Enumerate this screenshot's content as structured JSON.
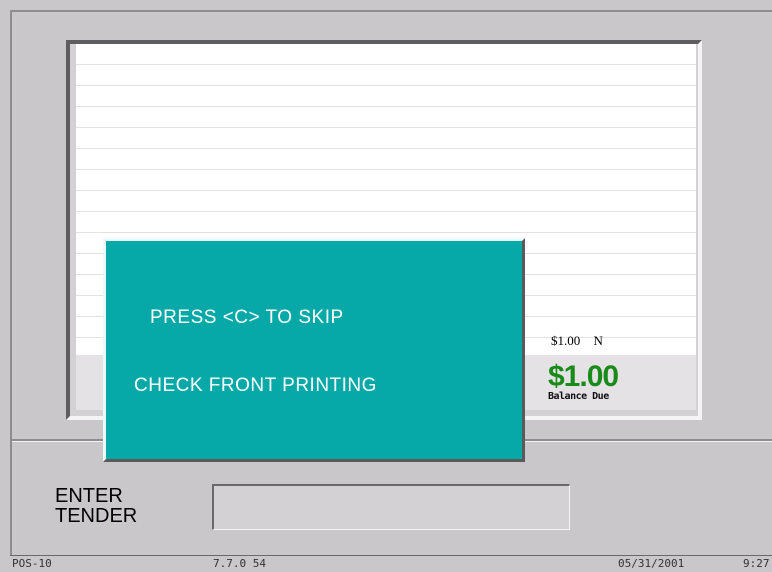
{
  "receipt": {
    "line_item_amount": "$1.00",
    "line_item_flag": "N",
    "balance_amount": "$1.00",
    "balance_label": "Balance Due"
  },
  "dialog": {
    "line1": "PRESS <C> TO SKIP",
    "line2": "CHECK FRONT PRINTING",
    "background_color": "#06a8a8"
  },
  "prompt": {
    "line1": "ENTER",
    "line2": "TENDER",
    "input_value": ""
  },
  "status": {
    "terminal": "POS-10",
    "version": "7.7.0 54",
    "date": "05/31/2001",
    "time": "9:27"
  },
  "colors": {
    "balance_green": "#1a8a1a",
    "background_gray": "#c9c7c9"
  }
}
